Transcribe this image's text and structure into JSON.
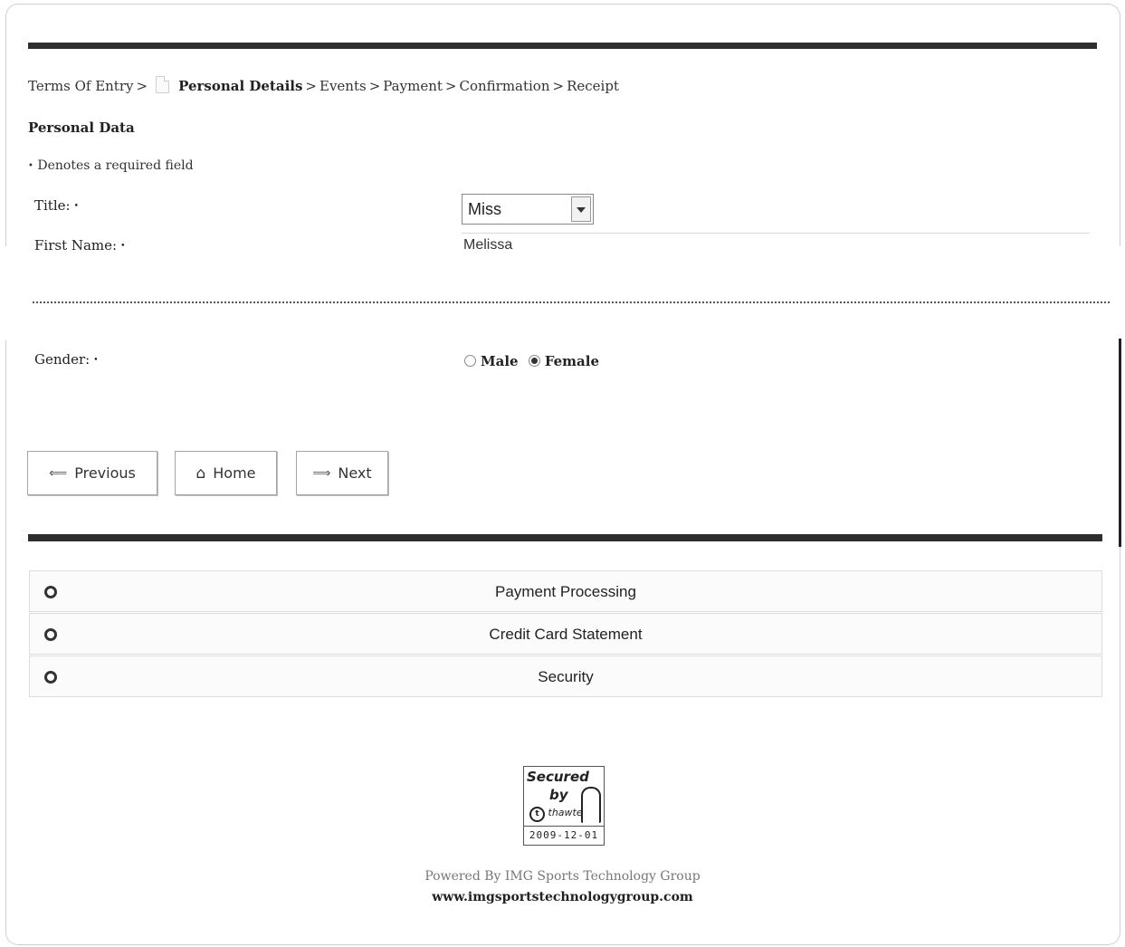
{
  "breadcrumb": {
    "items": [
      {
        "label": "Terms Of Entry"
      },
      {
        "label": "Personal Details",
        "active": true
      },
      {
        "label": "Events"
      },
      {
        "label": "Payment"
      },
      {
        "label": "Confirmation"
      },
      {
        "label": "Receipt"
      }
    ],
    "separator": ">"
  },
  "section_title": "Personal Data",
  "required_note": "Denotes a required field",
  "required_marker": "•",
  "fields": {
    "title": {
      "label": "Title:",
      "value": "Miss"
    },
    "first_name": {
      "label": "First Name:",
      "value": "Melissa"
    },
    "gender": {
      "label": "Gender:",
      "options": [
        {
          "label": "Male",
          "checked": false
        },
        {
          "label": "Female",
          "checked": true
        }
      ]
    }
  },
  "nav_buttons": {
    "previous": {
      "label": "Previous",
      "icon": "arrow-left-icon"
    },
    "home": {
      "label": "Home",
      "icon": "home-icon"
    },
    "next": {
      "label": "Next",
      "icon": "arrow-right-icon"
    }
  },
  "accordion": [
    {
      "title": "Payment Processing"
    },
    {
      "title": "Credit Card Statement"
    },
    {
      "title": "Security"
    }
  ],
  "security_badge": {
    "line1": "Secured",
    "line2": "by",
    "line3": "thawte",
    "date": "2009-12-01"
  },
  "footer": {
    "powered_by": "Powered By IMG Sports Technology Group",
    "url": "www.imgsportstechnologygroup.com"
  },
  "colors": {
    "rule": "#2e2e2e",
    "border": "#cfcfcf",
    "text": "#222222"
  }
}
